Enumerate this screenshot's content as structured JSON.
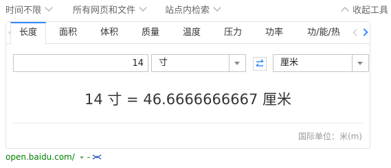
{
  "filters": {
    "time": "时间不限",
    "type": "所有网页和文件",
    "site": "站点内检索",
    "collapse": "收起工具"
  },
  "converter": {
    "tabs": [
      "长度",
      "面积",
      "体积",
      "质量",
      "温度",
      "压力",
      "功率",
      "功/能/热"
    ],
    "active_tab": "长度",
    "input_value": "14",
    "from_unit": "寸",
    "to_unit": "厘米",
    "result": "14 寸 = 46.6666666667 厘米",
    "si_unit": "国际单位：米(m)"
  },
  "source": {
    "url": "open.baidu.com/",
    "dash": "-"
  },
  "colors": {
    "accent": "#3388ff",
    "url_green": "#008000"
  }
}
